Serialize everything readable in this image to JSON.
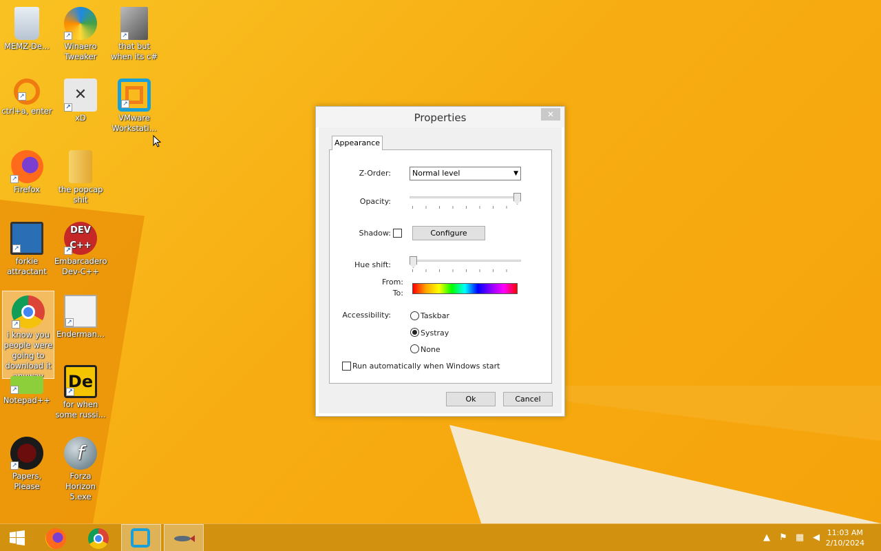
{
  "desktop": {
    "icons": [
      {
        "label": "MEMZ-De...",
        "icon": "recycle-bin-icon"
      },
      {
        "label": "Winaero Tweaker",
        "icon": "winaero-icon"
      },
      {
        "label": "that but when its c#",
        "icon": "stack-icon"
      },
      {
        "label": "ctrl+a, enter",
        "icon": "magnifier-icon"
      },
      {
        "label": "xD",
        "icon": "hxd-icon"
      },
      {
        "label": "VMware Workstati...",
        "icon": "vmware-icon"
      },
      {
        "label": "Firefox",
        "icon": "firefox-icon"
      },
      {
        "label": "the popcap shit",
        "icon": "folder-icon"
      },
      {
        "label": "forkie attractant",
        "icon": "monitor-gear-icon"
      },
      {
        "label": "Embarcadero Dev-C++",
        "icon": "devcpp-icon"
      },
      {
        "label": "i know you people were going to download it anyway",
        "icon": "chrome-icon"
      },
      {
        "label": "Enderman...",
        "icon": "window-icon"
      },
      {
        "label": "Notepad++",
        "icon": "notepadpp-icon"
      },
      {
        "label": "for when some russi...",
        "icon": "de-icon"
      },
      {
        "label": "Papers, Please",
        "icon": "papers-please-icon"
      },
      {
        "label": "Forza Horizon 5.exe",
        "icon": "flash-icon"
      }
    ]
  },
  "dialog": {
    "title": "Properties",
    "close_glyph": "✕",
    "tab_label": "Appearance",
    "zorder_label": "Z-Order:",
    "zorder_value": "Normal level",
    "opacity_label": "Opacity:",
    "opacity_level": 1.0,
    "shadow_label": "Shadow:",
    "configure_label": "Configure",
    "hue_label": "Hue shift:",
    "hue_level": 0.0,
    "from_label": "From:",
    "to_label": "To:",
    "accessibility_label": "Accessibility:",
    "options": [
      {
        "label": "Taskbar",
        "selected": false
      },
      {
        "label": "Systray",
        "selected": true
      },
      {
        "label": "None",
        "selected": false
      }
    ],
    "autorun_label": "Run automatically when Windows start",
    "ok_label": "Ok",
    "cancel_label": "Cancel"
  },
  "taskbar": {
    "start_icon": "windows-logo-icon",
    "clock_time": "11:03 AM",
    "clock_date": "2/10/2024",
    "colors": {
      "accent": "#d08f0e"
    }
  }
}
